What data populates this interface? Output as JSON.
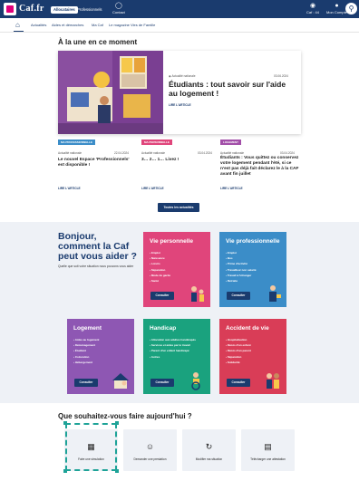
{
  "header": {
    "brand": "Caf.fr",
    "tabs": [
      {
        "label": "Allocataires",
        "active": true
      },
      {
        "label": "Professionnels",
        "active": false
      }
    ],
    "contact": {
      "label": "Contact",
      "icon": "chat-icon"
    },
    "region": {
      "label": "Caf : 44",
      "icon": "map-pin-icon"
    },
    "account": {
      "label": "Mon Compte",
      "icon": "user-icon"
    },
    "search_icon": "search-icon"
  },
  "subnav": {
    "home_icon": "home-icon",
    "items": [
      "Actualités",
      "Aides et démarches",
      "Ma Caf",
      "Le magazine Vies de Famille"
    ]
  },
  "une": {
    "heading": "À la une en ce moment",
    "featured": {
      "meta_label": "Actualité nationale",
      "date": "03.06.2024",
      "title": "Étudiants : tout savoir sur l'aide au logement !",
      "more": "LIRE L'ARTICLE"
    },
    "cards": [
      {
        "tag": "MA PROFESSIONNELLE",
        "tag_color": "#3b8dc8",
        "meta": "Actualité nationale",
        "date": "22.04.2024",
        "title": "Le nouvel Espace 'Professionnels' est disponible !",
        "more": "LIRE L'ARTICLE"
      },
      {
        "tag": "MA PERSONNELLE",
        "tag_color": "#e0457b",
        "meta": "Actualité nationale",
        "date": "03.04.2024",
        "title": "3… 2… 1… Livez !",
        "more": "LIRE L'ARTICLE"
      },
      {
        "tag": "LOGEMENT",
        "tag_color": "#a24ea8",
        "meta": "Actualité nationale",
        "date": "03.04.2024",
        "title": "Étudiants : Vous quittez ou conservez votre logement pendant l'été, si ce n'est pas déjà fait déclarez le à la CAF avant fin juillet",
        "more": "LIRE L'ARTICLE"
      }
    ],
    "all_news_button": "Toutes les actualités"
  },
  "profiles": {
    "heading": "Bonjour, comment la Caf peut vous aider ?",
    "subtext": "Quelle que soit votre situation nous pouvons vous aider",
    "tiles": [
      {
        "title": "Vie personnelle",
        "color": "#e0457b",
        "items": [
          "Emploi",
          "Naissance",
          "Loisirs",
          "Séparation",
          "Mode de garde",
          "Santé"
        ],
        "button": "Consulter"
      },
      {
        "title": "Vie professionnelle",
        "color": "#3b8dc8",
        "items": [
          "Emploi",
          "Bus",
          "Prime d'activité",
          "Travailleur non salarié",
          "Travail à l'étranger",
          "Retraite"
        ],
        "button": "Consulter"
      },
      {
        "title": "Logement",
        "color": "#8e57b3",
        "items": [
          "Aides au logement",
          "Déménagement",
          "Étudiant",
          "Colocation",
          "Hébergement"
        ],
        "button": "Consulter"
      },
      {
        "title": "Handicap",
        "color": "#1aa27e",
        "items": [
          "Allocation aux adultes handicapés",
          "Services et aides par le travail",
          "Parent d'un enfant handicapé",
          "Autres"
        ],
        "button": "Consulter"
      },
      {
        "title": "Accident de vie",
        "color": "#d93d57",
        "items": [
          "Hospitalisation",
          "Décès d'un enfant",
          "Décès d'un parent",
          "Séparation",
          "Solidarité"
        ],
        "button": "Consulter"
      }
    ]
  },
  "today": {
    "heading": "Que souhaitez-vous faire aujourd'hui ?",
    "actions": [
      {
        "label": "Faire une simulation",
        "icon": "calculator-icon"
      },
      {
        "label": "Demander une prestation",
        "icon": "person-icon"
      },
      {
        "label": "Modifier ma situation",
        "icon": "refresh-icon"
      },
      {
        "label": "Télécharger une attestation",
        "icon": "document-icon"
      }
    ]
  }
}
